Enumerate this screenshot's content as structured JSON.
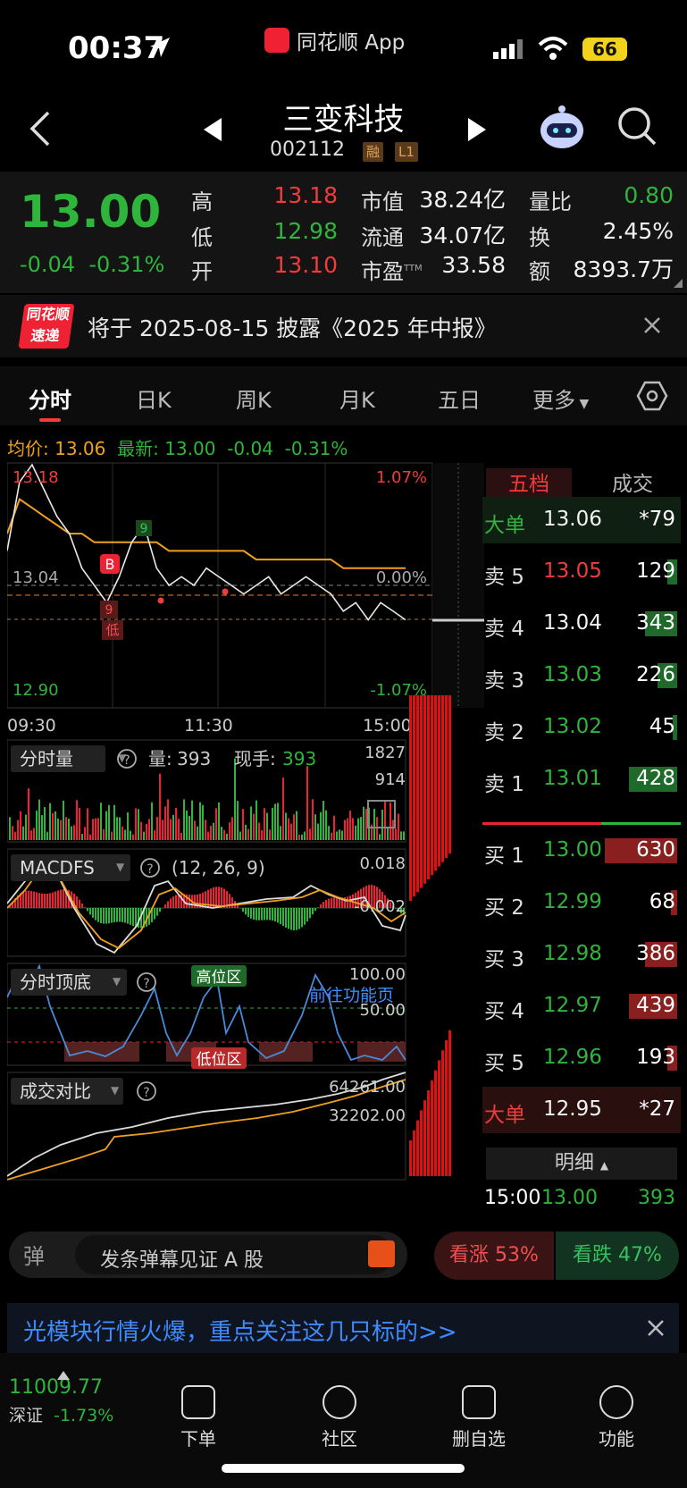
{
  "status": {
    "time": "00:37",
    "app": "同花顺 App",
    "battery": "66"
  },
  "header": {
    "name": "三变科技",
    "code": "002112",
    "tag1": "融",
    "tag2": "L1"
  },
  "quote": {
    "price": "13.00",
    "change": "-0.04",
    "change_pct": "-0.31%",
    "high_label": "高",
    "high": "13.18",
    "low_label": "低",
    "low": "12.98",
    "open_label": "开",
    "open": "13.10",
    "mcap_label": "市值",
    "mcap": "38.24亿",
    "float_label": "流通",
    "float": "34.07亿",
    "pe_label": "市盈",
    "pe_sup": "TTM",
    "pe": "33.58",
    "vr_label": "量比",
    "vr": "0.80",
    "turnover_label": "换",
    "turnover": "2.45%",
    "amount_label": "额",
    "amount": "8393.7万"
  },
  "notice": {
    "logo1": "同花顺",
    "logo2": "速递",
    "text": "将于 2025-08-15 披露《2025 年中报》"
  },
  "tabs": [
    "分时",
    "日K",
    "周K",
    "月K",
    "五日",
    "更多"
  ],
  "avg": {
    "avg_label": "均价:",
    "avg": "13.06",
    "latest_label": "最新:",
    "latest": "13.00",
    "chg": "-0.04",
    "pct": "-0.31%"
  },
  "chart": {
    "price_top": "13.18",
    "price_mid": "13.04",
    "price_bot": "12.90",
    "pct_top": "1.07%",
    "pct_mid": "0.00%",
    "pct_bot": "-1.07%",
    "t1": "09:30",
    "t2": "11:30",
    "t3": "15:00",
    "mark_b": "B",
    "mark_low": "低",
    "mark_9a": "9",
    "mark_9b": "9",
    "vol_label": "分时量",
    "vol_q": "量:",
    "vol_val": "393",
    "now_q": "现手:",
    "now_val": "393",
    "vol_max": "1827",
    "vol_mid": "914",
    "macd_label": "MACDFS",
    "macd_params": "(12, 26, 9)",
    "macd_top": "0.018",
    "macd_mid": "-0.002",
    "dd_label": "分时顶底",
    "dd_high": "高位区",
    "dd_low": "低位区",
    "dd_link": "前往功能页",
    "dd_top": "100.00",
    "dd_mid": "50.00",
    "cmp_label": "成交对比",
    "cmp_top": "64261.00",
    "cmp_mid": "32202.00"
  },
  "chart_data": {
    "type": "line",
    "x_labels": [
      "09:30",
      "11:30",
      "15:00"
    ],
    "y_range": [
      12.9,
      13.18
    ],
    "prev_close": 13.04,
    "series": [
      {
        "name": "最新",
        "values": [
          13.08,
          13.16,
          13.18,
          13.15,
          13.12,
          13.1,
          13.06,
          13.04,
          13.02,
          13.05,
          13.09,
          13.11,
          13.06,
          13.04,
          13.05,
          13.04,
          13.06,
          13.05,
          13.04,
          13.03,
          13.04,
          13.05,
          13.03,
          13.04,
          13.05,
          13.04,
          13.03,
          13.01,
          13.02,
          13.0,
          13.02,
          13.01,
          13.0
        ]
      },
      {
        "name": "均价",
        "values": [
          13.1,
          13.14,
          13.13,
          13.12,
          13.11,
          13.1,
          13.1,
          13.09,
          13.09,
          13.09,
          13.09,
          13.09,
          13.09,
          13.08,
          13.08,
          13.08,
          13.08,
          13.08,
          13.08,
          13.08,
          13.07,
          13.07,
          13.07,
          13.07,
          13.07,
          13.07,
          13.07,
          13.06,
          13.06,
          13.06,
          13.06,
          13.06,
          13.06
        ]
      }
    ]
  },
  "book": {
    "tab1": "五档",
    "tab2": "成交",
    "rows": [
      {
        "label": "大单",
        "price": "13.06",
        "vol": "*79",
        "pc": "#f2f2f2",
        "lc": "#2fb53c",
        "bar": "g",
        "bw": 0
      },
      {
        "label": "卖 5",
        "price": "13.05",
        "vol": "129",
        "pc": "#f23b3b",
        "lc": "#ddd",
        "bar": "g",
        "bw": 0.06
      },
      {
        "label": "卖 4",
        "price": "13.04",
        "vol": "343",
        "pc": "#f2f2f2",
        "lc": "#ddd",
        "bar": "g",
        "bw": 0.2
      },
      {
        "label": "卖 3",
        "price": "13.03",
        "vol": "226",
        "pc": "#2fb53c",
        "lc": "#ddd",
        "bar": "g",
        "bw": 0.12
      },
      {
        "label": "卖 2",
        "price": "13.02",
        "vol": "45",
        "pc": "#2fb53c",
        "lc": "#ddd",
        "bar": "g",
        "bw": 0.03
      },
      {
        "label": "卖 1",
        "price": "13.01",
        "vol": "428",
        "pc": "#2fb53c",
        "lc": "#ddd",
        "bar": "g",
        "bw": 0.3
      },
      {
        "label": "买 1",
        "price": "13.00",
        "vol": "630",
        "pc": "#2fb53c",
        "lc": "#ddd",
        "bar": "r",
        "bw": 0.45
      },
      {
        "label": "买 2",
        "price": "12.99",
        "vol": "68",
        "pc": "#2fb53c",
        "lc": "#ddd",
        "bar": "r",
        "bw": 0.04
      },
      {
        "label": "买 3",
        "price": "12.98",
        "vol": "386",
        "pc": "#2fb53c",
        "lc": "#ddd",
        "bar": "r",
        "bw": 0.2
      },
      {
        "label": "买 4",
        "price": "12.97",
        "vol": "439",
        "pc": "#2fb53c",
        "lc": "#ddd",
        "bar": "r",
        "bw": 0.3
      },
      {
        "label": "买 5",
        "price": "12.96",
        "vol": "193",
        "pc": "#2fb53c",
        "lc": "#ddd",
        "bar": "r",
        "bw": 0.06
      },
      {
        "label": "大单",
        "price": "12.95",
        "vol": "*27",
        "pc": "#f2f2f2",
        "lc": "#f23b3b",
        "bar": "r",
        "bw": 0
      }
    ],
    "detail": "明细",
    "trade_time": "15:00",
    "trade_price": "13.00",
    "trade_vol": "393"
  },
  "bottom": {
    "danmu_icon": "弹",
    "danmu": "发条弹幕见证 A 股",
    "up": "看涨 53%",
    "down": "看跌 47%",
    "ad": "光模块行情火爆，重点关注这几只标的>>",
    "index_val": "11009.77",
    "index_name": "深证",
    "index_pct": "-1.73%",
    "tb1": "下单",
    "tb2": "社区",
    "tb3": "删自选",
    "tb4": "功能"
  }
}
